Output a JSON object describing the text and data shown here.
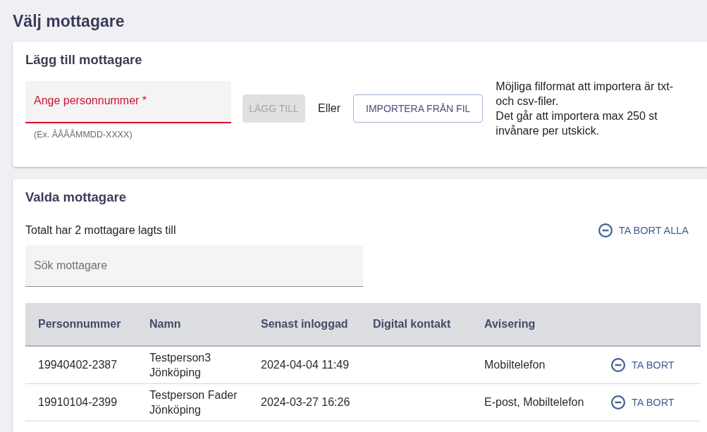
{
  "page": {
    "title": "Välj mottagare"
  },
  "add_recipient": {
    "heading": "Lägg till mottagare",
    "personnummer_field": {
      "placeholder": "Ange personnummer *",
      "hint": "(Ex. ÅÅÅÅMMDD-XXXX)",
      "invalid": true
    },
    "add_button": {
      "label": "LÄGG TILL",
      "disabled": true
    },
    "separator": "Eller",
    "import_button": {
      "label": "IMPORTERA FRÅN FIL"
    },
    "info": [
      "Möjliga filformat att importera är txt- och csv-filer.",
      "Det går att importera max 250 st invånare per utskick."
    ]
  },
  "selected_recipients": {
    "heading": "Valda mottagare",
    "summary": "Totalt har 2 mottagare lagts till",
    "remove_all_button": {
      "label": "TA BORT ALLA"
    },
    "search_field": {
      "placeholder": "Sök mottagare"
    },
    "table": {
      "columns": [
        "Personnummer",
        "Namn",
        "Senast inloggad",
        "Digital kontakt",
        "Avisering"
      ],
      "rows": [
        {
          "personnummer": "19940402-2387",
          "name": "Testperson3 Jönköping",
          "last_login": "2024-04-04 11:49",
          "notification": "Mobiltelefon",
          "remove_label": "TA BORT"
        },
        {
          "personnummer": "19910104-2399",
          "name": "Testperson Fader Jönköping",
          "last_login": "2024-03-27 16:26",
          "notification": "E-post, Mobiltelefon",
          "remove_label": "TA BORT"
        }
      ]
    }
  }
}
